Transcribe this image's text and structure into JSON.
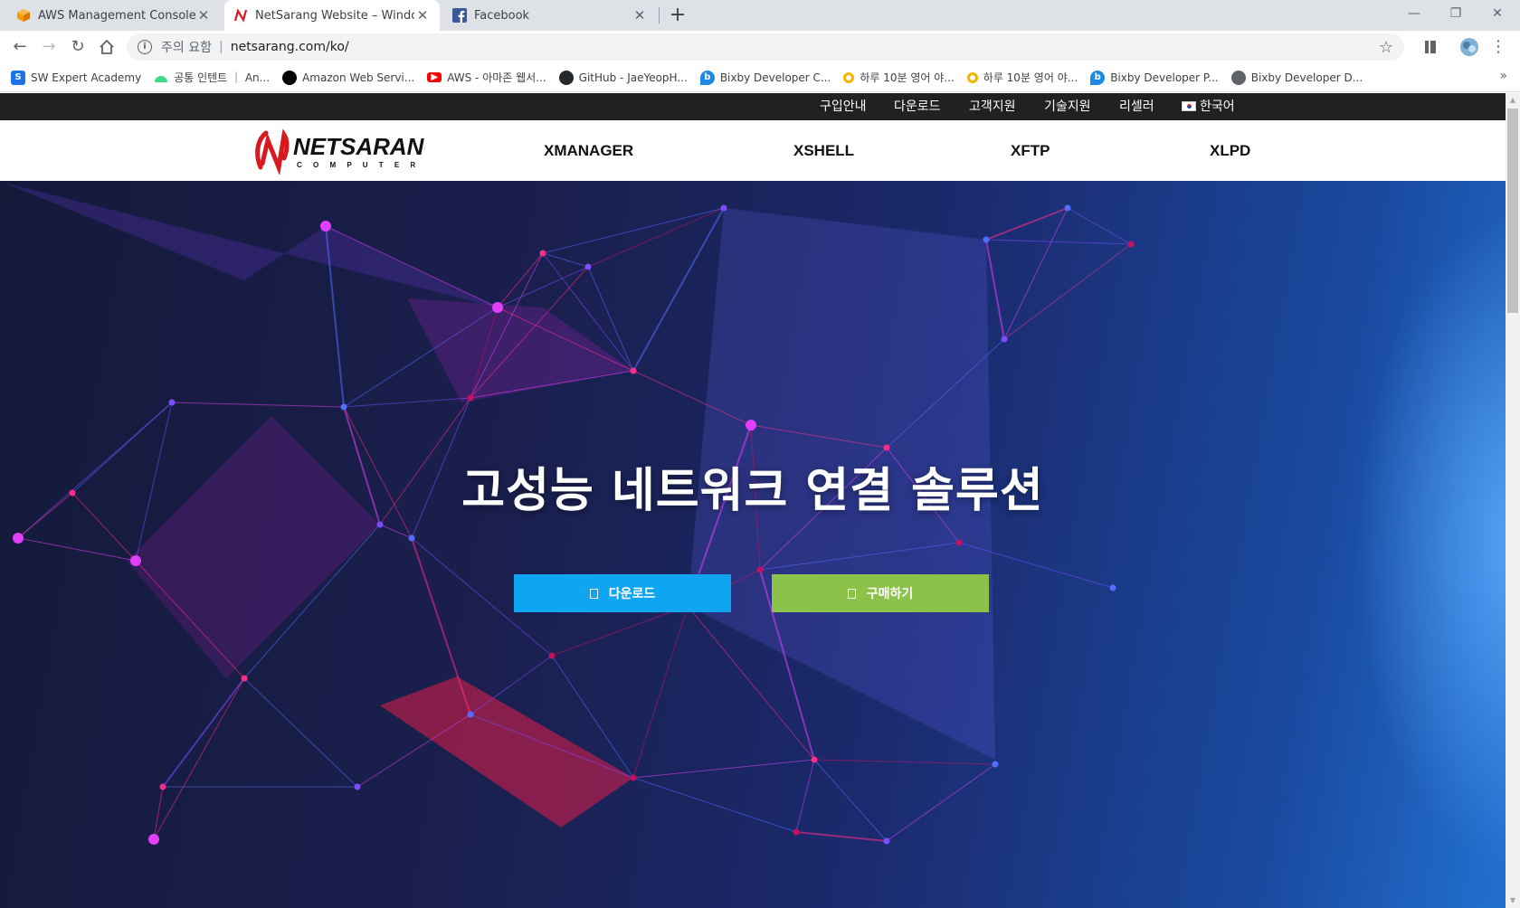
{
  "browser": {
    "tabs": [
      {
        "title": "AWS Management Console",
        "icon": "aws-cube-icon",
        "active": false
      },
      {
        "title": "NetSarang Website – Windows",
        "icon": "netsarang-icon",
        "active": true
      },
      {
        "title": "Facebook",
        "icon": "facebook-icon",
        "active": false
      }
    ],
    "address": {
      "security_label": "주의 요함",
      "url": "netsarang.com/ko/"
    },
    "bookmarks": [
      {
        "label": "SW Expert Academy",
        "icon": "swea-icon",
        "color": "#1a73e8"
      },
      {
        "label": "공통 인텐트 ｜ An...",
        "icon": "android-icon",
        "color": "#3ddc84"
      },
      {
        "label": "Amazon Web Servi...",
        "icon": "circle-icon",
        "color": "#000000"
      },
      {
        "label": "AWS - 아마존 웹서...",
        "icon": "youtube-icon",
        "color": "#ff0000"
      },
      {
        "label": "GitHub - JaeYeopH...",
        "icon": "github-icon",
        "color": "#24292e"
      },
      {
        "label": "Bixby Developer C...",
        "icon": "bixby-icon",
        "color": "#1e88e5"
      },
      {
        "label": "하루 10분 영어 야...",
        "icon": "ring-icon",
        "color": "#f4b400"
      },
      {
        "label": "하루 10분 영어 야...",
        "icon": "ring-icon",
        "color": "#f4b400"
      },
      {
        "label": "Bixby Developer P...",
        "icon": "bixby-icon",
        "color": "#1e88e5"
      },
      {
        "label": "Bixby Developer D...",
        "icon": "globe-icon",
        "color": "#5f6368"
      }
    ]
  },
  "site": {
    "topbar": {
      "links": [
        "구입안내",
        "다운로드",
        "고객지원",
        "기술지원",
        "리셀러"
      ],
      "language": "한국어"
    },
    "logo": {
      "word": "NETSARANG",
      "sub": "C O M P U T E R"
    },
    "nav": [
      "XMANAGER",
      "XSHELL",
      "XFTP",
      "XLPD"
    ],
    "hero": {
      "headline": "고성능 네트워크 연결 솔루션",
      "download_label": "다운로드",
      "buy_label": "구매하기",
      "download_color": "#0ea5f1",
      "buy_color": "#8bc34a"
    }
  }
}
